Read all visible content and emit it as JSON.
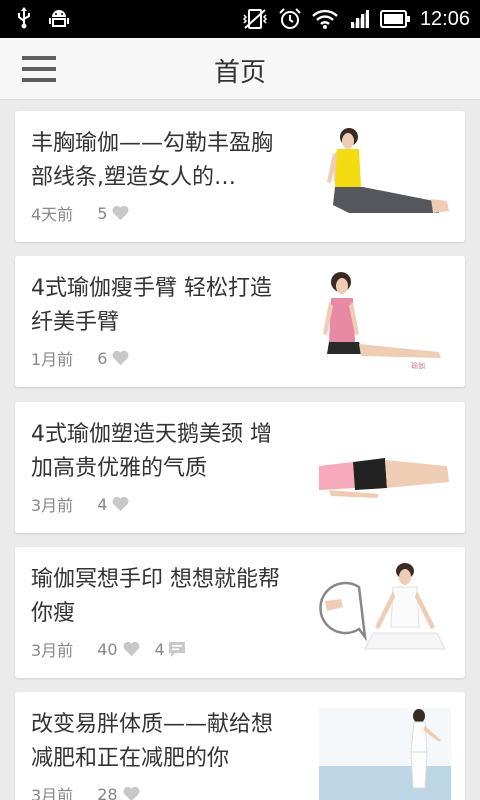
{
  "status_bar": {
    "time": "12:06"
  },
  "header": {
    "title": "首页"
  },
  "articles": [
    {
      "title": "丰胸瑜伽——勾勒丰盈胸部线条,塑造女人的…",
      "time": "4天前",
      "likes": "5",
      "comments": ""
    },
    {
      "title": "4式瑜伽瘦手臂 轻松打造纤美手臂",
      "time": "1月前",
      "likes": "6",
      "comments": ""
    },
    {
      "title": "4式瑜伽塑造天鹅美颈 增加高贵优雅的气质",
      "time": "3月前",
      "likes": "4",
      "comments": ""
    },
    {
      "title": "瑜伽冥想手印 想想就能帮你瘦",
      "time": "3月前",
      "likes": "40",
      "comments": "4"
    },
    {
      "title": "改变易胖体质——献给想减肥和正在减肥的你",
      "time": "3月前",
      "likes": "28",
      "comments": ""
    }
  ],
  "colors": {
    "background": "#ebebeb",
    "card": "#ffffff",
    "meta_text": "#888888",
    "title_text": "#333333"
  }
}
